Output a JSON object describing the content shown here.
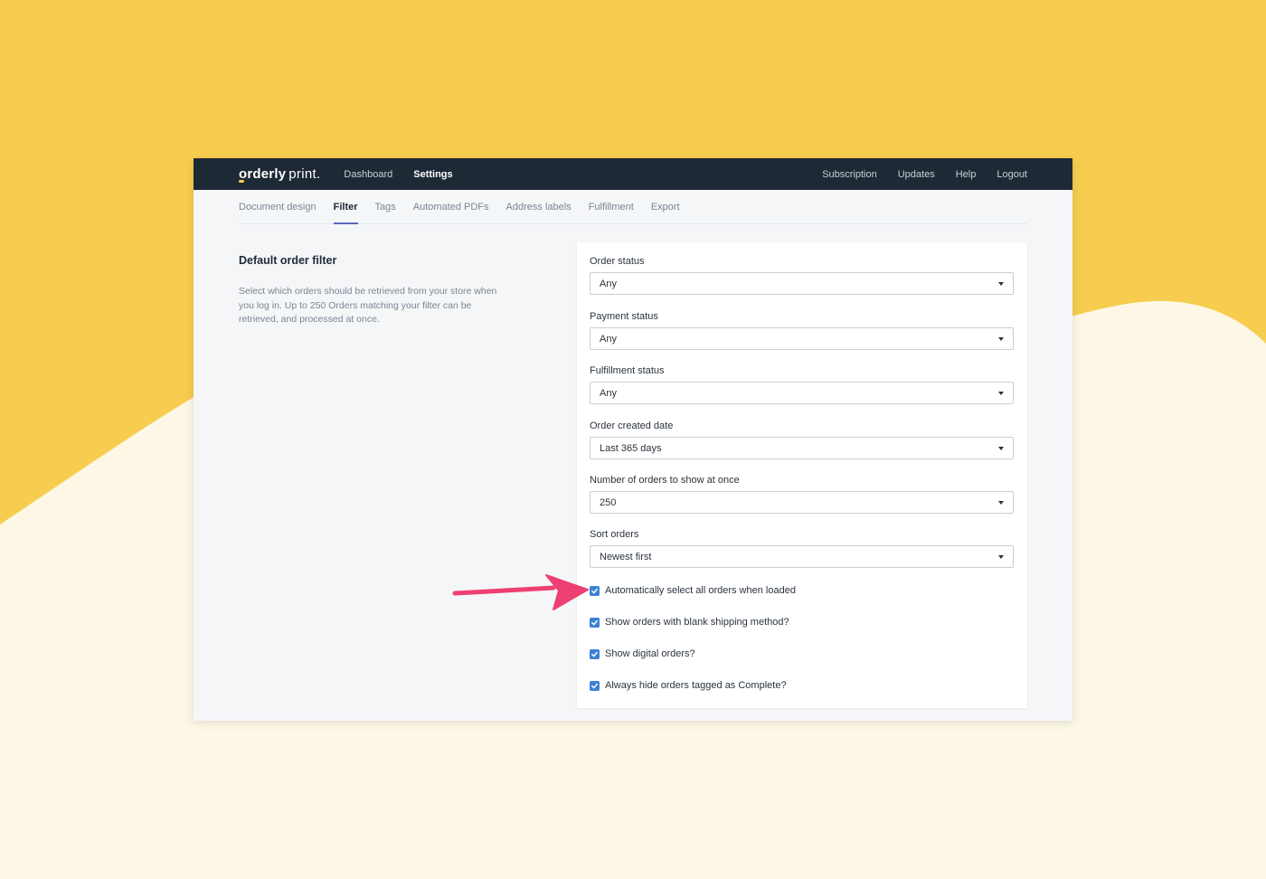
{
  "colors": {
    "background_yellow": "#f7cd4f",
    "background_cream": "#fdf8e6",
    "topbar": "#1e2936",
    "accent": "#5b6ab8",
    "checkbox": "#3b82d6",
    "arrow": "#ee3f72"
  },
  "brand": {
    "name_bold": "orderly",
    "name_light": "print."
  },
  "topnav": {
    "left": [
      {
        "label": "Dashboard",
        "active": false
      },
      {
        "label": "Settings",
        "active": true
      }
    ],
    "right": [
      {
        "label": "Subscription"
      },
      {
        "label": "Updates"
      },
      {
        "label": "Help"
      },
      {
        "label": "Logout"
      }
    ]
  },
  "subnav": [
    {
      "label": "Document design",
      "active": false
    },
    {
      "label": "Filter",
      "active": true
    },
    {
      "label": "Tags",
      "active": false
    },
    {
      "label": "Automated PDFs",
      "active": false
    },
    {
      "label": "Address labels",
      "active": false
    },
    {
      "label": "Fulfillment",
      "active": false
    },
    {
      "label": "Export",
      "active": false
    }
  ],
  "section": {
    "title": "Default order filter",
    "description": "Select which orders should be retrieved from your store when you log in. Up to 250 Orders matching your filter can be retrieved, and processed at once."
  },
  "fields": [
    {
      "label": "Order status",
      "value": "Any"
    },
    {
      "label": "Payment status",
      "value": "Any"
    },
    {
      "label": "Fulfillment status",
      "value": "Any"
    },
    {
      "label": "Order created date",
      "value": "Last 365 days"
    },
    {
      "label": "Number of orders to show at once",
      "value": "250"
    },
    {
      "label": "Sort orders",
      "value": "Newest first"
    }
  ],
  "checkboxes": [
    {
      "label": "Automatically select all orders when loaded",
      "checked": true
    },
    {
      "label": "Show orders with blank shipping method?",
      "checked": true
    },
    {
      "label": "Show digital orders?",
      "checked": true
    },
    {
      "label": "Always hide orders tagged as Complete?",
      "checked": true
    }
  ],
  "icons": {
    "arrow": "pointer-arrow-icon",
    "caret": "caret-down-icon",
    "check": "checkmark-icon"
  }
}
